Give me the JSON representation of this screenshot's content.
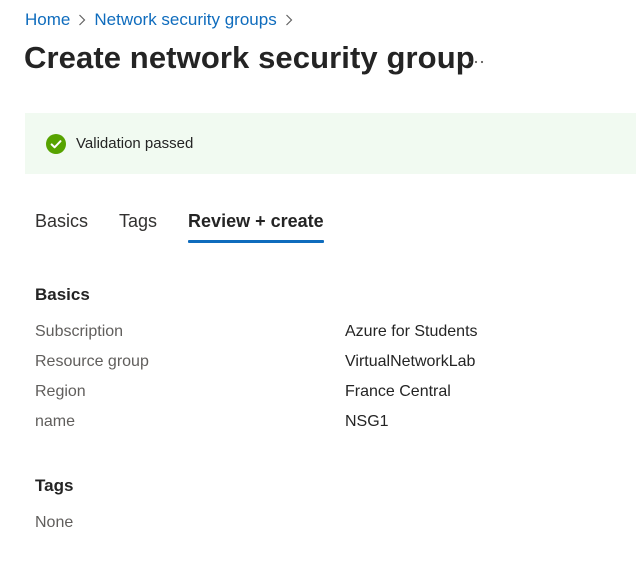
{
  "breadcrumb": {
    "items": [
      {
        "label": "Home"
      },
      {
        "label": "Network security groups"
      }
    ]
  },
  "page": {
    "title": "Create network security group",
    "more_label": "..."
  },
  "banner": {
    "message": "Validation passed",
    "icon": "checkmark-circle-icon",
    "color": "#57a300",
    "background": "#f1faf1"
  },
  "tabs": [
    {
      "label": "Basics",
      "active": false
    },
    {
      "label": "Tags",
      "active": false
    },
    {
      "label": "Review + create",
      "active": true
    }
  ],
  "basics": {
    "heading": "Basics",
    "rows": [
      {
        "label": "Subscription",
        "value": "Azure for Students"
      },
      {
        "label": "Resource group",
        "value": "VirtualNetworkLab"
      },
      {
        "label": "Region",
        "value": "France Central"
      },
      {
        "label": "name",
        "value": "NSG1"
      }
    ]
  },
  "tags": {
    "heading": "Tags",
    "value": "None"
  },
  "colors": {
    "link": "#0f6cbd",
    "accent": "#0f6cbd",
    "success": "#57a300"
  }
}
